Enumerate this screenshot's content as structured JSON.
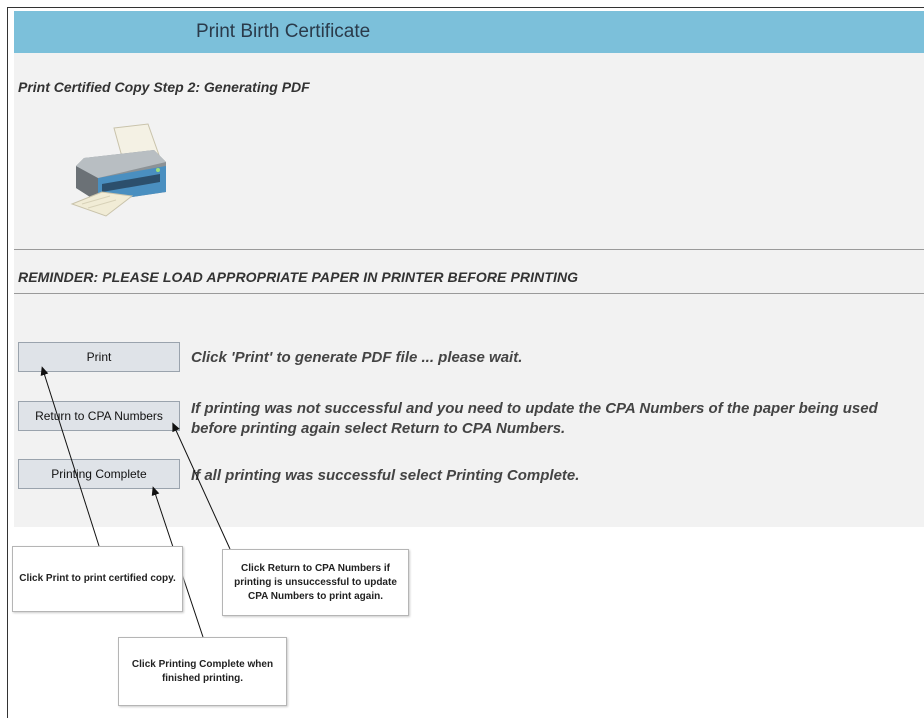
{
  "header": {
    "title": "Print Birth Certificate"
  },
  "step_title": "Print Certified Copy Step 2: Generating PDF",
  "reminder": "REMINDER: PLEASE LOAD APPROPRIATE PAPER IN PRINTER BEFORE PRINTING",
  "buttons": {
    "print": "Print",
    "return": "Return to CPA Numbers",
    "complete": "Printing Complete"
  },
  "descriptions": {
    "print": "Click 'Print' to generate PDF file ... please wait.",
    "return": "If printing was not successful and you need to update the CPA Numbers of the paper being used before printing again select Return to CPA Numbers.",
    "complete": "If all printing was successful select Printing Complete."
  },
  "callouts": {
    "print": "Click Print to print certified copy.",
    "return": "Click Return to CPA Numbers if printing is unsuccessful to update CPA Numbers to print again.",
    "complete": "Click Printing Complete when finished printing."
  },
  "icons": {
    "printer": "printer-icon"
  }
}
